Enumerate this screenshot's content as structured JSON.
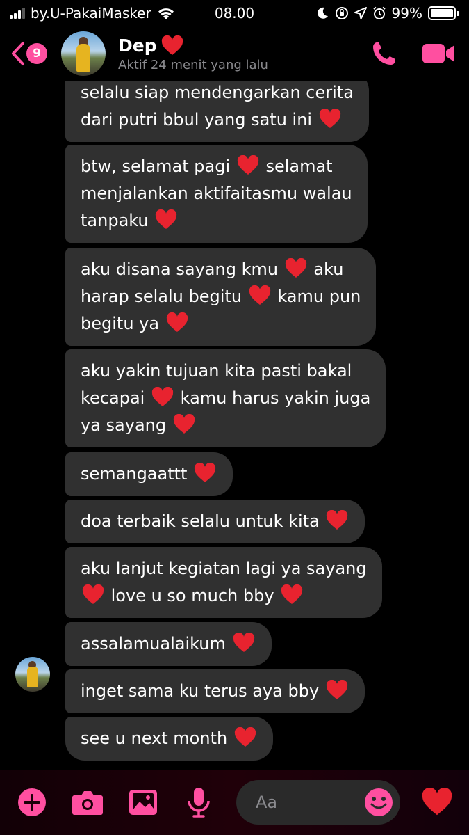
{
  "status_bar": {
    "carrier": "by.U-PakaiMasker",
    "time": "08.00",
    "battery": "99%",
    "battery_level": 0.99
  },
  "header": {
    "unread_count": "9",
    "contact_name": "Dep",
    "contact_status": "Aktif 24 menit yang lalu"
  },
  "messages": [
    {
      "lines": [
        [
          "selalu siap mendengarkan cerita"
        ],
        [
          "dari putri bbul yang satu ini",
          "heart"
        ]
      ]
    },
    {
      "lines": [
        [
          "btw, selamat pagi",
          "heart",
          "selamat"
        ],
        [
          "menjalankan aktifaitasmu walau"
        ],
        [
          "tanpaku",
          "heart"
        ]
      ]
    },
    {
      "lines": [
        [
          "aku disana sayang kmu",
          "heart",
          "aku"
        ],
        [
          "harap selalu begitu",
          "heart",
          "kamu pun"
        ],
        [
          "begitu ya",
          "heart"
        ]
      ]
    },
    {
      "lines": [
        [
          "aku yakin tujuan kita pasti bakal"
        ],
        [
          "kecapai",
          "heart",
          "kamu harus yakin juga"
        ],
        [
          "ya sayang",
          "heart"
        ]
      ]
    },
    {
      "lines": [
        [
          "semangaattt",
          "heart"
        ]
      ]
    },
    {
      "lines": [
        [
          "doa terbaik selalu untuk kita",
          "heart"
        ]
      ]
    },
    {
      "lines": [
        [
          "aku lanjut kegiatan lagi ya sayang"
        ],
        [
          "heart",
          "love u so much bby",
          "heart"
        ]
      ]
    },
    {
      "lines": [
        [
          "assalamualaikum",
          "heart"
        ]
      ]
    },
    {
      "lines": [
        [
          "inget sama ku terus aya bby",
          "heart"
        ]
      ]
    },
    {
      "lines": [
        [
          "see u next month",
          "heart"
        ]
      ]
    }
  ],
  "composer": {
    "placeholder": "Aa"
  },
  "colors": {
    "accent": "#ff4fa0",
    "bubble": "#303030",
    "heart": "#e8232f"
  },
  "icons": [
    "back-chevron-icon",
    "phone-icon",
    "video-camera-icon",
    "plus-icon",
    "camera-icon",
    "image-icon",
    "microphone-icon",
    "emoji-icon",
    "heart-icon"
  ]
}
